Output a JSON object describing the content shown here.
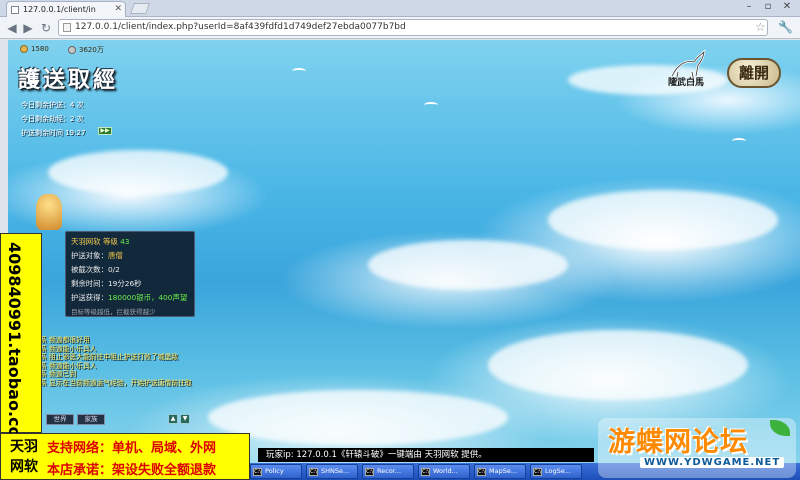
{
  "browser": {
    "tab_title": "127.0.0.1/client/in",
    "url": "127.0.0.1/client/index.php?userId=8af439fdfd1d749def27ebda0077b7bd"
  },
  "game": {
    "title": "護送取經",
    "top_stats": [
      "1580",
      "3620万"
    ],
    "info": {
      "line1": "今日剩余护送：4 次",
      "line2": "今日剩余劫经：2 次",
      "line3": "护送剩余时间 19:27"
    },
    "mount_label": "隆武白馬",
    "leave_label": "離開",
    "escort_panel": {
      "name": "天羽网软",
      "level_label": "等级",
      "level": "43",
      "target_label": "护送对象：",
      "target": "唐僧",
      "robbed_label": "被截次数：",
      "robbed": "0/2",
      "time_label": "剩余时间：",
      "time": "19分26秒",
      "reward_label": "护送获得：",
      "reward": "180000银币，400声望",
      "hint": "目标等级越低，拦截获得越少"
    },
    "chat_lines": [
      "系  频道都很好用",
      "系  频道能小乐具人",
      "系  阻止邪恶大能前往中阻止护送打败了城堡敌",
      "系  频道能小乐具人",
      "系  频道已到",
      "系  显示在当前频道运气经验，开始护送唐僧前往取"
    ],
    "chat_tabs": [
      "世界",
      "家族"
    ]
  },
  "overlay": {
    "shop_id": "409840991.taobao.com",
    "brand": "天羽网软",
    "promo_line1": "支持网络：单机、局域、外网",
    "promo_line2": "本店承诺：架设失败全额退款",
    "server_msg": "玩家ip: 127.0.0.1《轩辕斗破》一键端由 天羽网软 提供。",
    "site_logo": "游蝶网论坛",
    "site_url": "WWW.YDWGAME.NET"
  },
  "taskbar": {
    "items": [
      "Policy",
      "SHNSe...",
      "Recor...",
      "World...",
      "MapSe...",
      "LogSe..."
    ]
  },
  "colors": {
    "sea": "#3aa5dc",
    "promo_yellow": "#ffff00",
    "panel_bg": "#0a121e",
    "reward_green": "#6cf04a",
    "taskbar_blue": "#1d4fb8"
  }
}
